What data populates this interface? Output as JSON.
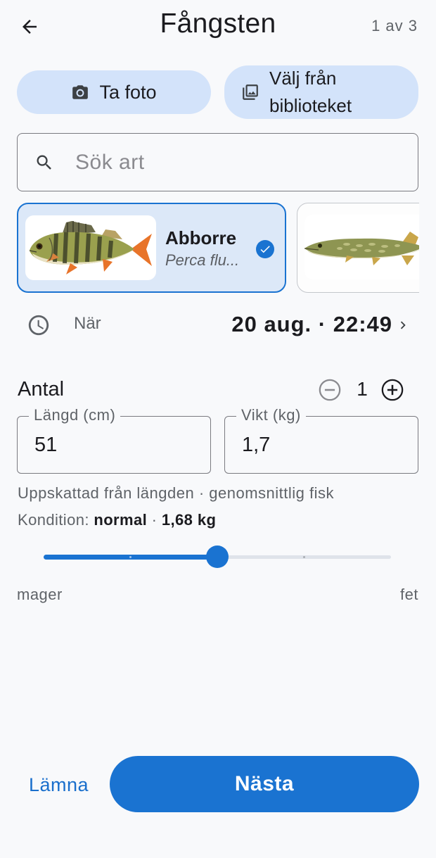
{
  "header": {
    "title": "Fångsten",
    "step": "1 av 3"
  },
  "photo": {
    "take_label": "Ta foto",
    "library_label_1": "Välj från",
    "library_label_2": "biblioteket"
  },
  "search": {
    "placeholder": "Sök art",
    "value": ""
  },
  "species": [
    {
      "name": "Abborre",
      "latin": "Perca flu...",
      "selected": true
    },
    {
      "name": "",
      "latin": "",
      "selected": false
    }
  ],
  "when": {
    "label": "När",
    "value": "20 aug. · 22:49"
  },
  "count": {
    "label": "Antal",
    "value": "1"
  },
  "length": {
    "label": "Längd (cm)",
    "value": "51"
  },
  "weight": {
    "label": "Vikt (kg)",
    "value": "1,7"
  },
  "hint": "Uppskattad från längden · genomsnittlig fisk",
  "condition": {
    "prefix": "Kondition:",
    "state": "normal",
    "sep": "·",
    "weight": "1,68 kg"
  },
  "slider": {
    "min_label": "mager",
    "max_label": "fet",
    "value_fraction": 0.5,
    "steps": 4
  },
  "footer": {
    "leave_label": "Lämna",
    "next_label": "Nästa"
  },
  "colors": {
    "accent": "#1a73d1",
    "pill": "#d3e3fa",
    "card_selected": "#dce8f8"
  }
}
